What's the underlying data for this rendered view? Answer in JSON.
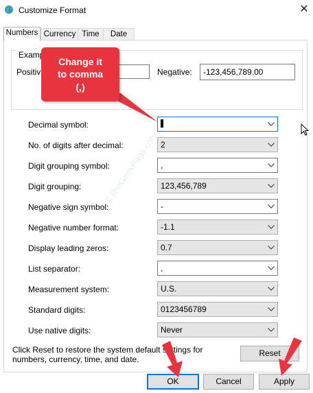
{
  "window": {
    "title": "Customize Format",
    "close_glyph": "✕"
  },
  "tabs": [
    {
      "label": "Numbers",
      "active": true
    },
    {
      "label": "Currency",
      "active": false
    },
    {
      "label": "Time",
      "active": false
    },
    {
      "label": "Date",
      "active": false
    }
  ],
  "examples": {
    "group_label": "Examp",
    "positive_label": "Positiv",
    "positive_value": "",
    "negative_label": "Negative:",
    "negative_value": "-123,456,789.00"
  },
  "settings": [
    {
      "label": "Decimal symbol:",
      "value": ".",
      "kind": "edit"
    },
    {
      "label": "No. of digits after decimal:",
      "value": "2",
      "kind": "list"
    },
    {
      "label": "Digit grouping symbol:",
      "value": ",",
      "kind": "edit"
    },
    {
      "label": "Digit grouping:",
      "value": "123,456,789",
      "kind": "list"
    },
    {
      "label": "Negative sign symbol:",
      "value": "-",
      "kind": "edit"
    },
    {
      "label": "Negative number format:",
      "value": "-1.1",
      "kind": "list"
    },
    {
      "label": "Display leading zeros:",
      "value": "0.7",
      "kind": "list"
    },
    {
      "label": "List separator:",
      "value": ",",
      "kind": "edit"
    },
    {
      "label": "Measurement system:",
      "value": "U.S.",
      "kind": "list"
    },
    {
      "label": "Standard digits:",
      "value": "0123456789",
      "kind": "list"
    },
    {
      "label": "Use native digits:",
      "value": "Never",
      "kind": "list"
    }
  ],
  "info_text": "Click Reset to restore the system default settings for numbers, currency, time, and date.",
  "buttons": {
    "reset": "Reset",
    "ok": "OK",
    "cancel": "Cancel",
    "apply": "Apply"
  },
  "callout": {
    "line1": "Change it",
    "line2": "to comma",
    "line3": "(,)"
  },
  "watermark": "©TheGeekPage.com",
  "colors": {
    "accent": "#0078d7",
    "annotation": "#e8343e"
  }
}
